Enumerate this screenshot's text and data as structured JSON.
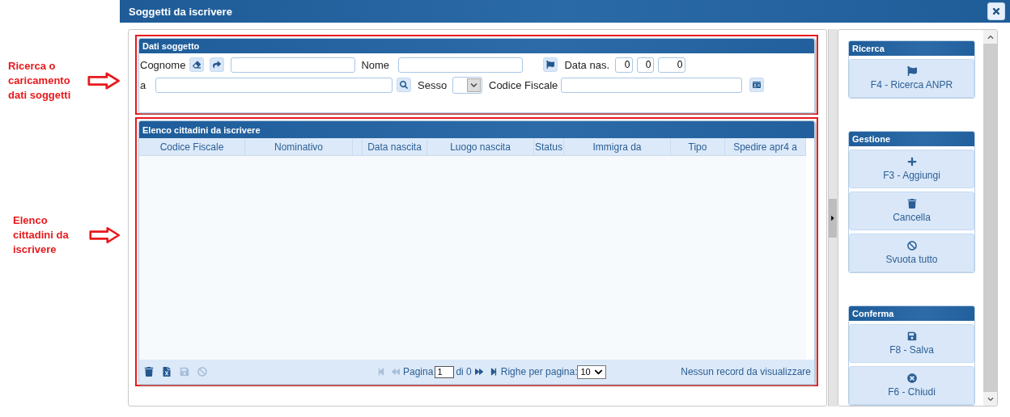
{
  "annotations": [
    {
      "lines": [
        "Ricerca o",
        "caricamento",
        "dati soggetti"
      ]
    },
    {
      "lines": [
        "Elenco",
        "cittadini da",
        "iscrivere"
      ]
    }
  ],
  "dialog": {
    "title": "Soggetti da iscrivere"
  },
  "search_panel": {
    "title": "Dati soggetto",
    "cognome_label": "Cognome",
    "nome_label": "Nome",
    "date_label": "Data nas.",
    "date_values": [
      "0",
      "0",
      "0"
    ],
    "place_label": "a",
    "sex_label": "Sesso",
    "cf_label": "Codice Fiscale"
  },
  "list_panel": {
    "title": "Elenco cittadini da iscrivere",
    "columns": [
      "Codice Fiscale",
      "Nominativo",
      "Data nascita",
      "Luogo nascita",
      "Status",
      "Immigra da",
      "Tipo",
      "Spedire apr4 a"
    ],
    "footer": {
      "tools": [
        {
          "kind": "trash",
          "disabled": false
        },
        {
          "kind": "export",
          "disabled": false
        },
        {
          "kind": "save",
          "disabled": true
        },
        {
          "kind": "ban",
          "disabled": true
        }
      ],
      "pager_back": [
        {
          "kind": "first",
          "disabled": true
        },
        {
          "kind": "prev",
          "disabled": true
        }
      ],
      "page_label": "Pagina",
      "page_value": "1",
      "of_label": "di 0",
      "pager_forward": [
        {
          "kind": "next",
          "disabled": false
        },
        {
          "kind": "last",
          "disabled": false
        }
      ],
      "rows_label": "Righe per pagina:",
      "rows_value": "10",
      "status": "Nessun record da visualizzare"
    }
  },
  "side_groups": [
    {
      "title": "Ricerca",
      "buttons": [
        {
          "kind": "flag",
          "label": "F4 - Ricerca ANPR"
        }
      ]
    },
    {
      "title": "Gestione",
      "buttons": [
        {
          "kind": "plus",
          "label": "F3 - Aggiungi"
        },
        {
          "kind": "trash",
          "label": "Cancella"
        },
        {
          "kind": "ban",
          "label": "Svuota tutto"
        }
      ]
    },
    {
      "title": "Conferma",
      "buttons": [
        {
          "kind": "save",
          "label": "F8 - Salva"
        },
        {
          "kind": "close",
          "label": "F6 - Chiudi"
        }
      ]
    }
  ]
}
